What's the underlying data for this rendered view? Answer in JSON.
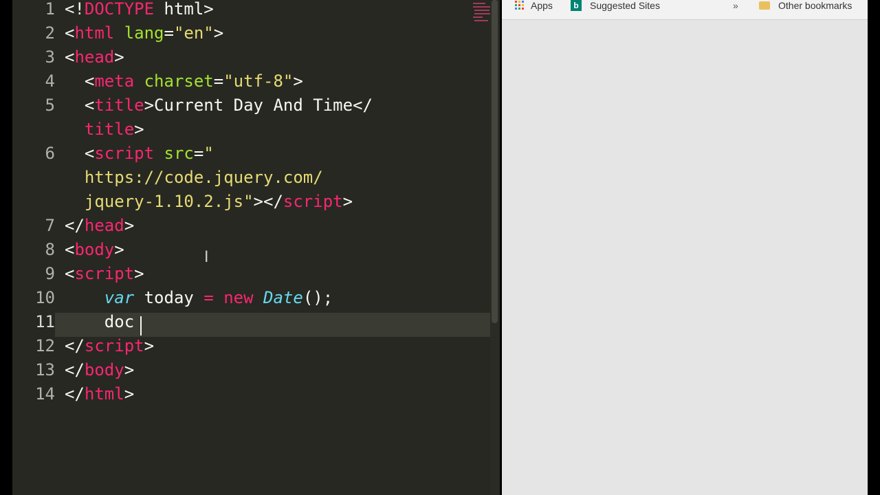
{
  "editor": {
    "line_numbers": [
      "1",
      "2",
      "3",
      "4",
      "5",
      "",
      "6",
      "",
      "",
      "7",
      "8",
      "9",
      "10",
      "11",
      "12",
      "13",
      "14"
    ],
    "lines": [
      {
        "num": "1",
        "tokens": [
          {
            "c": "t-plain",
            "t": "<!"
          },
          {
            "c": "t-tag",
            "t": "DOCTYPE"
          },
          {
            "c": "t-plain",
            "t": " html>"
          }
        ]
      },
      {
        "num": "2",
        "tokens": [
          {
            "c": "t-plain",
            "t": "<"
          },
          {
            "c": "t-tag",
            "t": "html"
          },
          {
            "c": "t-plain",
            "t": " "
          },
          {
            "c": "t-attr",
            "t": "lang"
          },
          {
            "c": "t-plain",
            "t": "="
          },
          {
            "c": "t-str",
            "t": "\"en\""
          },
          {
            "c": "t-plain",
            "t": ">"
          }
        ]
      },
      {
        "num": "3",
        "tokens": [
          {
            "c": "t-plain",
            "t": "<"
          },
          {
            "c": "t-tag",
            "t": "head"
          },
          {
            "c": "t-plain",
            "t": ">"
          }
        ]
      },
      {
        "num": "4",
        "tokens": [
          {
            "c": "t-plain",
            "t": "  <"
          },
          {
            "c": "t-tag",
            "t": "meta"
          },
          {
            "c": "t-plain",
            "t": " "
          },
          {
            "c": "t-attr",
            "t": "charset"
          },
          {
            "c": "t-plain",
            "t": "="
          },
          {
            "c": "t-str",
            "t": "\"utf-8\""
          },
          {
            "c": "t-plain",
            "t": ">"
          }
        ]
      },
      {
        "num": "5",
        "tokens": [
          {
            "c": "t-plain",
            "t": "  <"
          },
          {
            "c": "t-tag",
            "t": "title"
          },
          {
            "c": "t-plain",
            "t": ">Current Day And Time</"
          }
        ]
      },
      {
        "num": "",
        "tokens": [
          {
            "c": "t-tag",
            "t": "  title"
          },
          {
            "c": "t-plain",
            "t": ">"
          }
        ]
      },
      {
        "num": "6",
        "tokens": [
          {
            "c": "t-plain",
            "t": "  <"
          },
          {
            "c": "t-tag",
            "t": "script"
          },
          {
            "c": "t-plain",
            "t": " "
          },
          {
            "c": "t-attr",
            "t": "src"
          },
          {
            "c": "t-plain",
            "t": "="
          },
          {
            "c": "t-str",
            "t": "\""
          }
        ]
      },
      {
        "num": "",
        "tokens": [
          {
            "c": "t-str",
            "t": "  https://code.jquery.com/"
          }
        ]
      },
      {
        "num": "",
        "tokens": [
          {
            "c": "t-str",
            "t": "  jquery-1.10.2.js\""
          },
          {
            "c": "t-plain",
            "t": "></"
          },
          {
            "c": "t-tag",
            "t": "script"
          },
          {
            "c": "t-plain",
            "t": ">"
          }
        ]
      },
      {
        "num": "7",
        "tokens": [
          {
            "c": "t-plain",
            "t": "</"
          },
          {
            "c": "t-tag",
            "t": "head"
          },
          {
            "c": "t-plain",
            "t": ">"
          }
        ]
      },
      {
        "num": "8",
        "tokens": [
          {
            "c": "t-plain",
            "t": "<"
          },
          {
            "c": "t-tag",
            "t": "body"
          },
          {
            "c": "t-plain",
            "t": ">"
          }
        ]
      },
      {
        "num": "9",
        "tokens": [
          {
            "c": "t-plain",
            "t": "<"
          },
          {
            "c": "t-tag",
            "t": "script"
          },
          {
            "c": "t-plain",
            "t": ">"
          }
        ]
      },
      {
        "num": "10",
        "tokens": [
          {
            "c": "t-plain",
            "t": "    "
          },
          {
            "c": "t-kw",
            "t": "var"
          },
          {
            "c": "t-plain",
            "t": " today "
          },
          {
            "c": "t-op",
            "t": "="
          },
          {
            "c": "t-plain",
            "t": " "
          },
          {
            "c": "t-new",
            "t": "new"
          },
          {
            "c": "t-plain",
            "t": " "
          },
          {
            "c": "t-type",
            "t": "Date"
          },
          {
            "c": "t-plain",
            "t": "();"
          }
        ]
      },
      {
        "num": "11",
        "tokens": [
          {
            "c": "t-plain",
            "t": "    doc"
          }
        ]
      },
      {
        "num": "12",
        "tokens": [
          {
            "c": "t-plain",
            "t": "</"
          },
          {
            "c": "t-tag",
            "t": "script"
          },
          {
            "c": "t-plain",
            "t": ">"
          }
        ]
      },
      {
        "num": "13",
        "tokens": [
          {
            "c": "t-plain",
            "t": "</"
          },
          {
            "c": "t-tag",
            "t": "body"
          },
          {
            "c": "t-plain",
            "t": ">"
          }
        ]
      },
      {
        "num": "14",
        "tokens": [
          {
            "c": "t-plain",
            "t": "</"
          },
          {
            "c": "t-tag",
            "t": "html"
          },
          {
            "c": "t-plain",
            "t": ">"
          }
        ]
      }
    ],
    "active_line": "11"
  },
  "browser": {
    "bookmarks": {
      "apps_label": "Apps",
      "suggested_label": "Suggested Sites",
      "overflow_label": "»",
      "other_label": "Other bookmarks"
    }
  },
  "colors": {
    "editor_bg": "#272822",
    "tag": "#f92672",
    "attr": "#a6e22e",
    "string": "#e6db74",
    "keyword": "#66d9ef",
    "browser_bg": "#e5e5e5"
  },
  "icons": [
    "apps-grid-icon",
    "bing-icon",
    "folder-icon",
    "text-cursor-icon"
  ]
}
